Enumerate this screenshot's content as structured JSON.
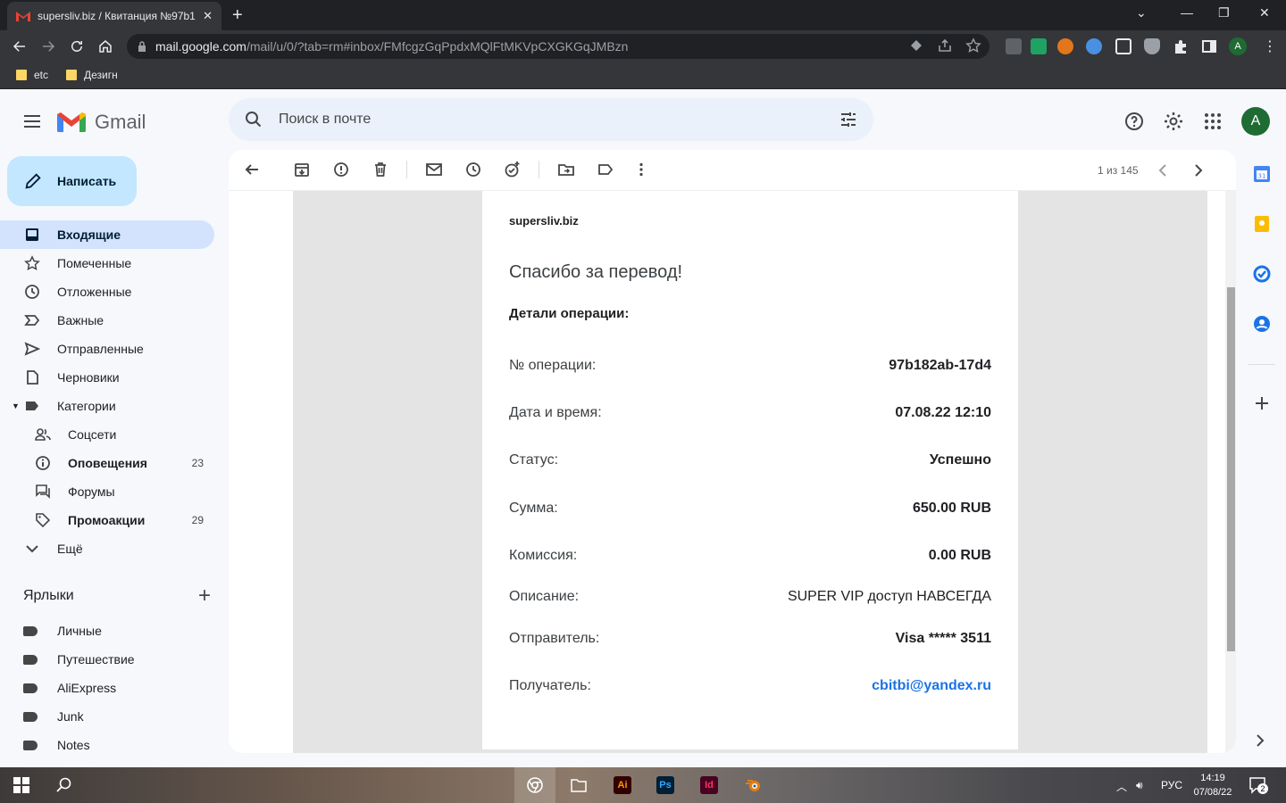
{
  "browser": {
    "tab_title": "supersliv.biz / Квитанция №97b1",
    "url_host": "mail.google.com",
    "url_path": "/mail/u/0/?tab=rm#inbox/FMfcgzGqPpdxMQlFtMKVpCXGKGqJMBzn",
    "profile_initial": "A",
    "bookmarks": [
      "etc",
      "Дезигн"
    ]
  },
  "gmail": {
    "logo_text": "Gmail",
    "search_placeholder": "Поиск в почте",
    "avatar_initial": "A",
    "compose_label": "Написать"
  },
  "sidebar": {
    "items": [
      {
        "label": "Входящие"
      },
      {
        "label": "Помеченные"
      },
      {
        "label": "Отложенные"
      },
      {
        "label": "Важные"
      },
      {
        "label": "Отправленные"
      },
      {
        "label": "Черновики"
      },
      {
        "label": "Категории"
      },
      {
        "label": "Соцсети"
      },
      {
        "label": "Оповещения",
        "count": "23"
      },
      {
        "label": "Форумы"
      },
      {
        "label": "Промоакции",
        "count": "29"
      },
      {
        "label": "Ещё"
      }
    ],
    "labels_title": "Ярлыки",
    "labels": [
      "Личные",
      "Путешествие",
      "AliExpress",
      "Junk",
      "Notes"
    ]
  },
  "toolbar": {
    "pager_text": "1 из 145"
  },
  "email": {
    "brand": "supersliv.biz",
    "heading": "Спасибо за перевод!",
    "details_title": "Детали операции:",
    "rows": [
      {
        "key": "№ операции:",
        "value": "97b182ab-17d4"
      },
      {
        "key": "Дата и время:",
        "value": "07.08.22 12:10"
      },
      {
        "key": "Статус:",
        "value": "Успешно"
      },
      {
        "key": "Сумма:",
        "value": "650.00 RUB"
      },
      {
        "key": "Комиссия:",
        "value": "0.00 RUB"
      },
      {
        "key": "Описание:",
        "value": "SUPER VIP доступ НАВСЕГДА"
      },
      {
        "key": "Отправитель:",
        "value_prefix": "Visa",
        "value": "***** 3511"
      },
      {
        "key": "Получатель:",
        "value": "cbitbi@yandex.ru"
      }
    ]
  },
  "taskbar": {
    "tray_lang": "РУС",
    "time": "14:19",
    "date": "07/08/22",
    "notifications": "2",
    "apps": [
      "Ai",
      "Ps",
      "Id"
    ]
  },
  "colors": {
    "accent": "#1a73e8",
    "compose_bg": "#c2e7ff",
    "active_nav": "#d3e3fd"
  }
}
